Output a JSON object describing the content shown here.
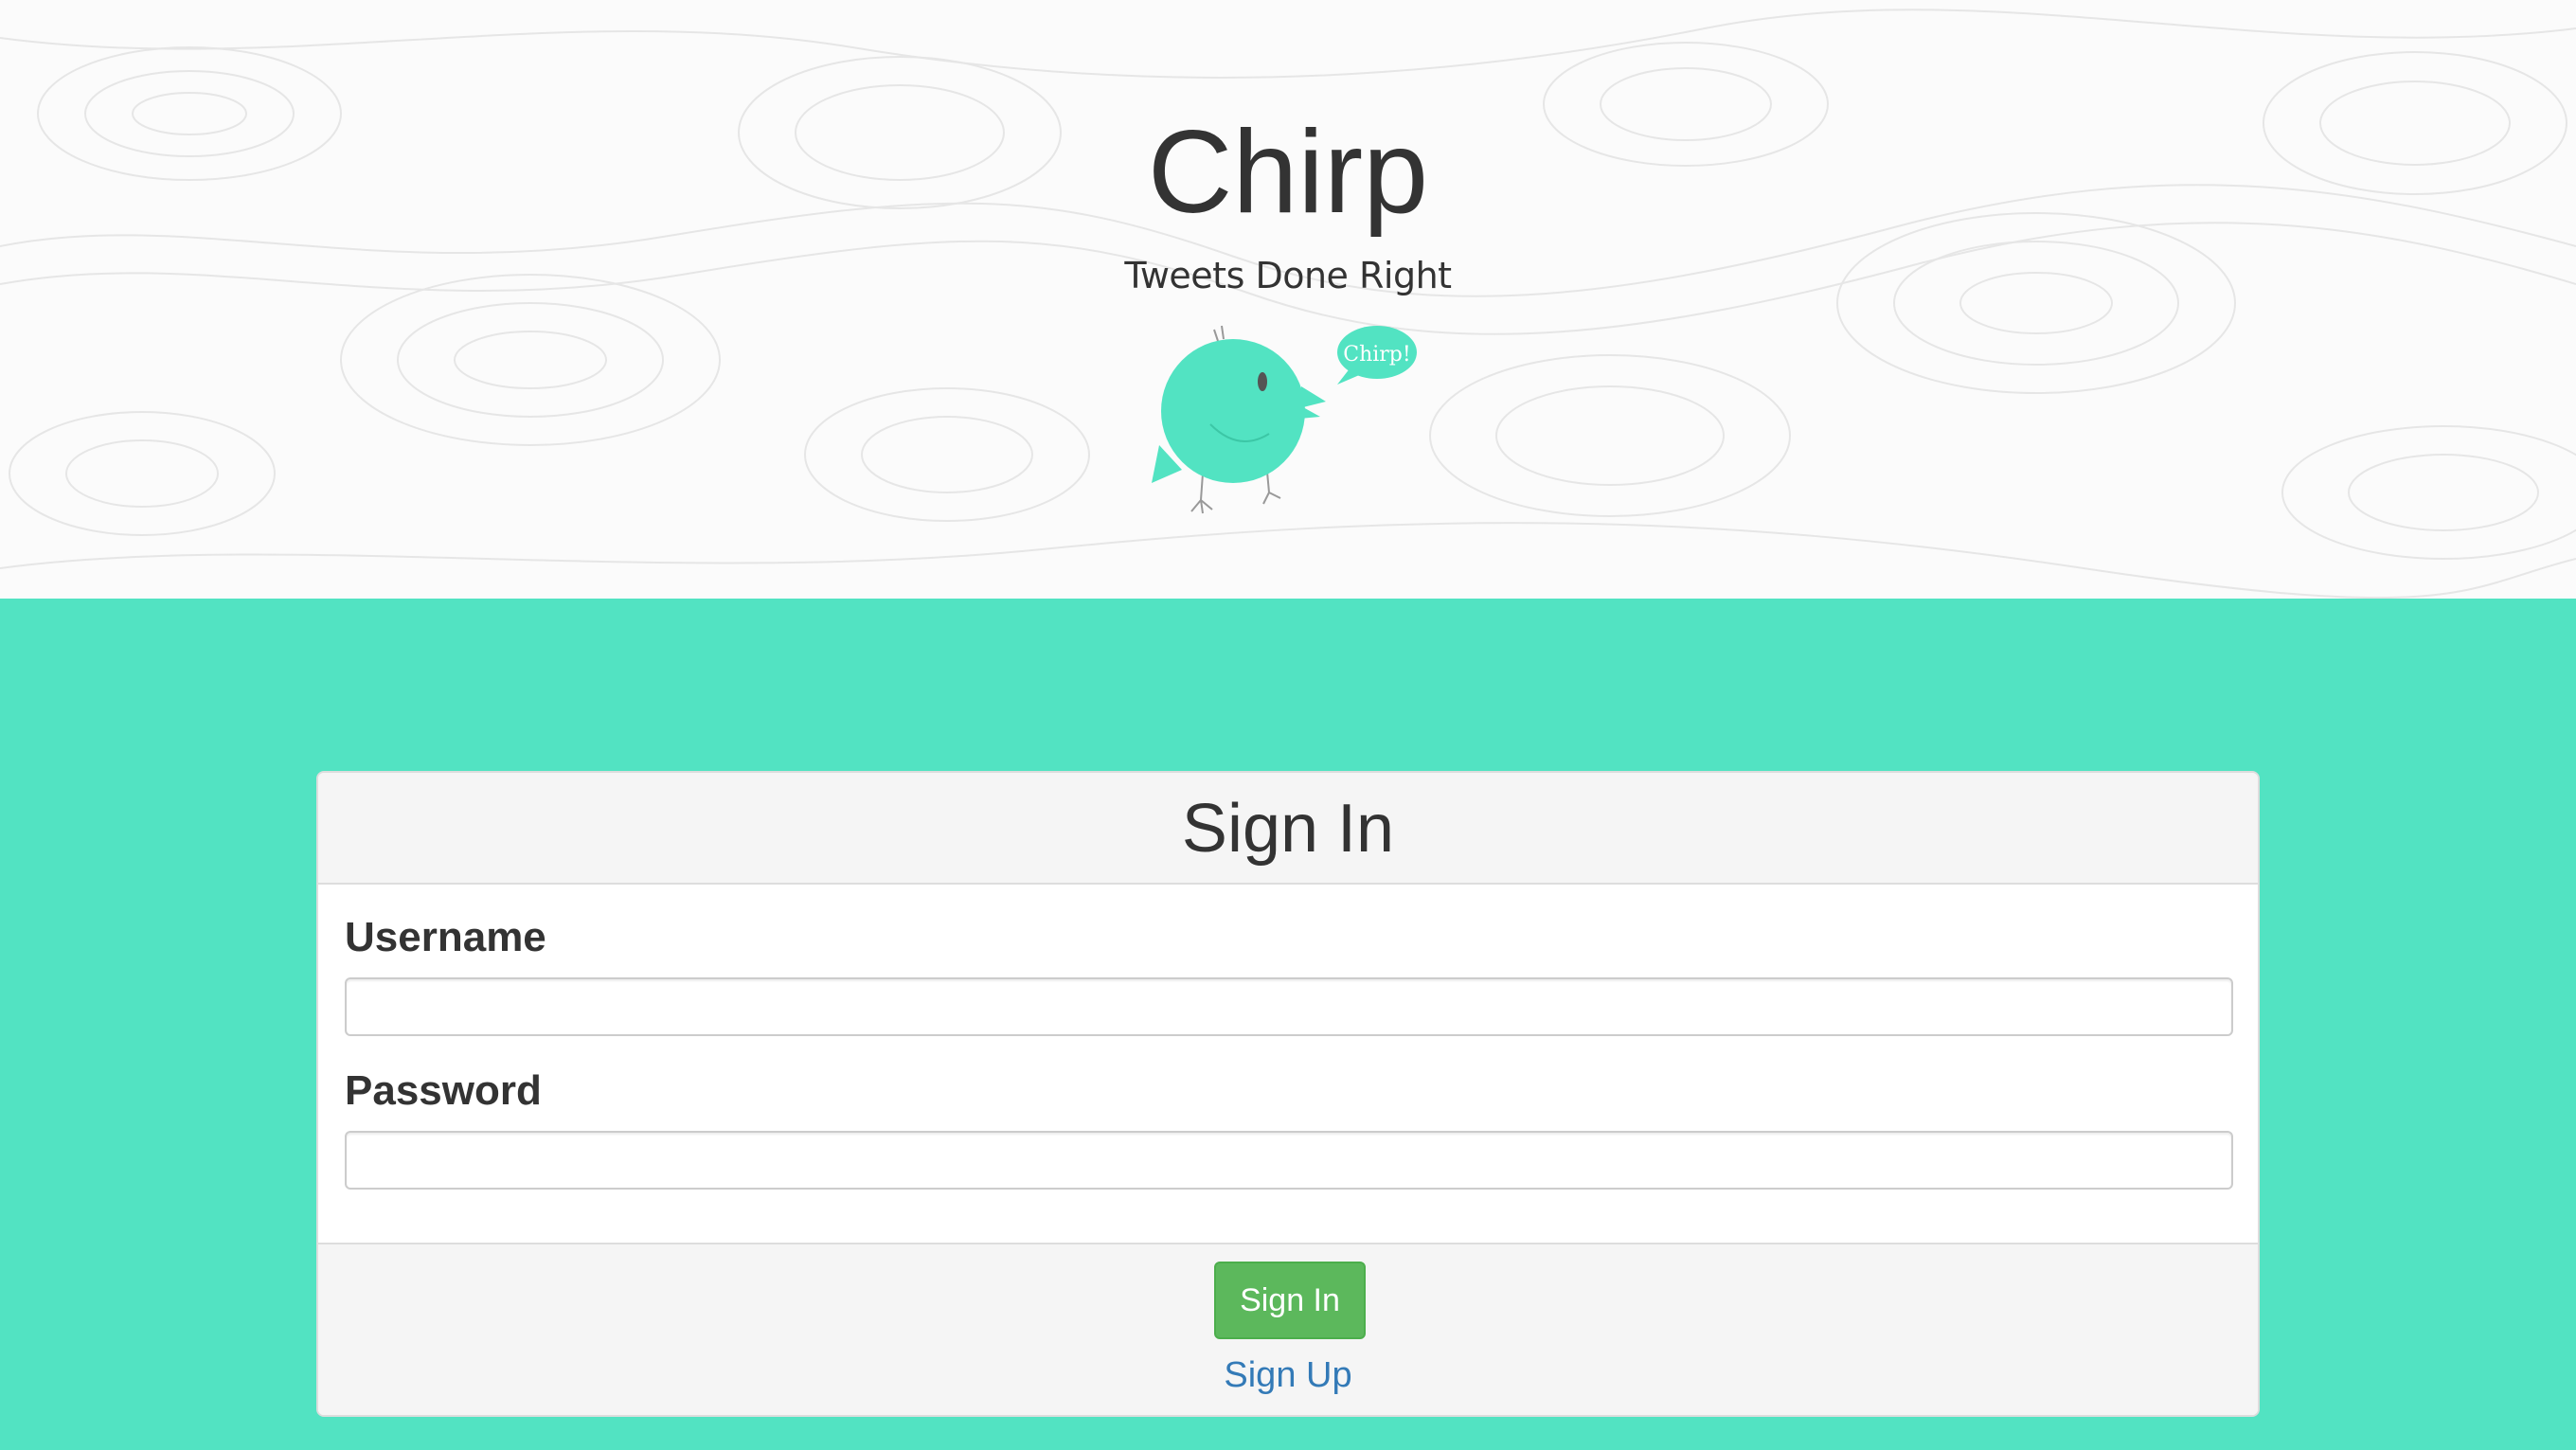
{
  "header": {
    "title": "Chirp",
    "tagline": "Tweets Done Right",
    "mascot_bubble_text": "Chirp!",
    "mascot_icon": "bird-mascot-icon"
  },
  "signin_form": {
    "heading": "Sign In",
    "username_label": "Username",
    "username_value": "",
    "password_label": "Password",
    "password_value": "",
    "submit_label": "Sign In",
    "signup_link_label": "Sign Up"
  },
  "colors": {
    "accent": "#52e3c2",
    "submit_button": "#5cb85c",
    "link": "#337ab7",
    "text": "#333333"
  }
}
